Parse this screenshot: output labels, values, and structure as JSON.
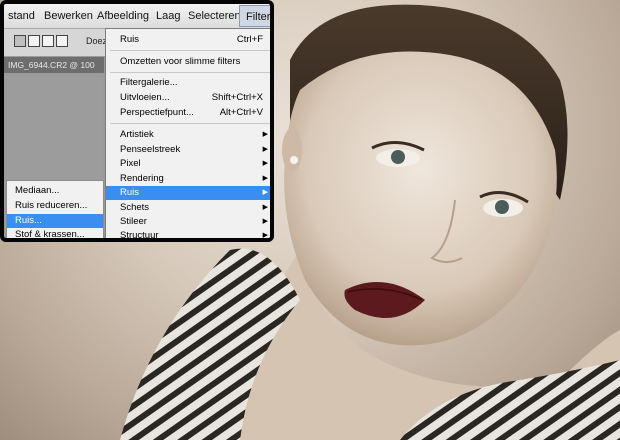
{
  "menubar": {
    "items": [
      {
        "label": "stand"
      },
      {
        "label": "Bewerken"
      },
      {
        "label": "Afbeelding"
      },
      {
        "label": "Laag"
      },
      {
        "label": "Selecteren"
      },
      {
        "label": "Filter"
      }
    ]
  },
  "options_bar": {
    "label": "Doez"
  },
  "document": {
    "tab_title": "IMG_6944.CR2 @ 100"
  },
  "filter_menu": {
    "items": [
      {
        "label": "Ruis",
        "shortcut": "Ctrl+F"
      },
      {
        "label": "Omzetten voor slimme filters"
      },
      {
        "label": "Filtergalerie..."
      },
      {
        "label": "Uitvloeien...",
        "shortcut": "Shift+Ctrl+X"
      },
      {
        "label": "Perspectiefpunt...",
        "shortcut": "Alt+Ctrl+V"
      },
      {
        "label": "Artistiek",
        "arrow": "▶"
      },
      {
        "label": "Penseelstreek",
        "arrow": "▶"
      },
      {
        "label": "Pixel",
        "arrow": "▶"
      },
      {
        "label": "Rendering",
        "arrow": "▶"
      },
      {
        "label": "Ruis",
        "arrow": "▶",
        "highlighted": true
      },
      {
        "label": "Schets",
        "arrow": "▶"
      },
      {
        "label": "Stileer",
        "arrow": "▶"
      },
      {
        "label": "Structuur",
        "arrow": "▶"
      }
    ]
  },
  "ruis_submenu": {
    "items": [
      {
        "label": "Mediaan..."
      },
      {
        "label": "Ruis reduceren..."
      },
      {
        "label": "Ruis...",
        "highlighted": true
      },
      {
        "label": "Stof & krassen..."
      }
    ]
  },
  "colors": {
    "highlight": "#3a8ef0",
    "menu_bg": "#f1f1f1",
    "photo_tone": "#d8cbbd"
  }
}
